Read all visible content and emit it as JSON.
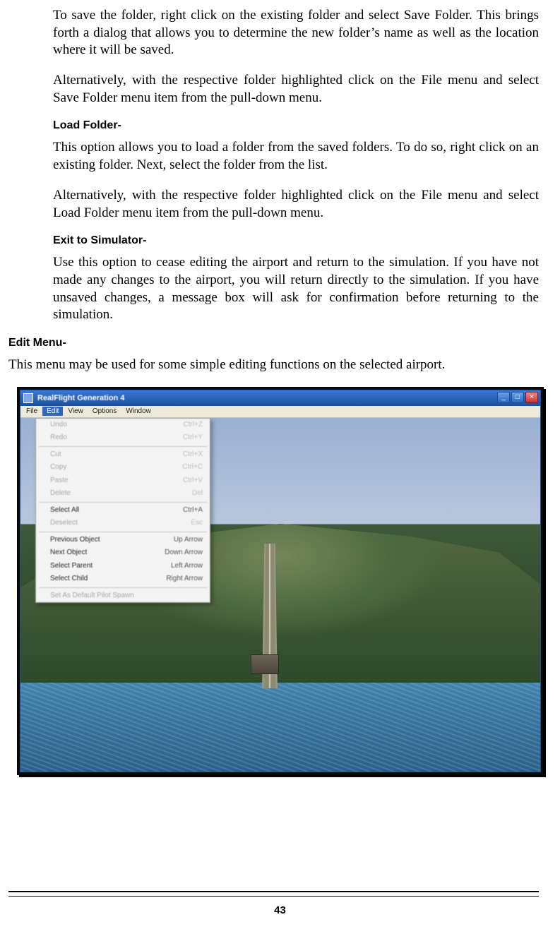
{
  "saveFolder": {
    "p1": "To save the folder, right click on the existing folder and select Save Folder. This brings forth a dialog that allows you to determine the new folder’s name as well as the location where it will be saved.",
    "p2": "Alternatively, with the respective folder highlighted click on the File menu and select Save Folder menu item from the pull-down menu."
  },
  "loadFolder": {
    "heading": "Load Folder-",
    "p1": "This option allows you to load a folder from the saved folders.  To do so, right click on an existing folder.  Next, select the folder from the list.",
    "p2": "Alternatively, with the respective folder highlighted click on the File menu and select Load Folder menu item from the pull-down menu."
  },
  "exitSim": {
    "heading": "Exit to Simulator-",
    "p1": "Use this option to cease editing the airport and return to the simulation.  If you have not made any changes to the airport, you will return directly to the simulation.  If you have unsaved changes, a message box will ask for confirmation before returning to the simulation."
  },
  "editMenu": {
    "heading": "Edit Menu-",
    "p1": "This menu may be used for some simple editing functions on the selected airport."
  },
  "window": {
    "title": "RealFlight Generation 4",
    "menus": {
      "file": "File",
      "edit": "Edit",
      "view": "View",
      "options": "Options",
      "window": "Window"
    },
    "editMenu": {
      "undo": {
        "label": "Undo",
        "shortcut": "Ctrl+Z",
        "enabled": false
      },
      "redo": {
        "label": "Redo",
        "shortcut": "Ctrl+Y",
        "enabled": false
      },
      "cut": {
        "label": "Cut",
        "shortcut": "Ctrl+X",
        "enabled": false
      },
      "copy": {
        "label": "Copy",
        "shortcut": "Ctrl+C",
        "enabled": false
      },
      "paste": {
        "label": "Paste",
        "shortcut": "Ctrl+V",
        "enabled": false
      },
      "delete": {
        "label": "Delete",
        "shortcut": "Del",
        "enabled": false
      },
      "selectAll": {
        "label": "Select All",
        "shortcut": "Ctrl+A",
        "enabled": true
      },
      "deselect": {
        "label": "Deselect",
        "shortcut": "Esc",
        "enabled": false
      },
      "prevObj": {
        "label": "Previous Object",
        "shortcut": "Up Arrow",
        "enabled": true
      },
      "nextObj": {
        "label": "Next Object",
        "shortcut": "Down Arrow",
        "enabled": true
      },
      "selParent": {
        "label": "Select Parent",
        "shortcut": "Left Arrow",
        "enabled": true
      },
      "selChild": {
        "label": "Select Child",
        "shortcut": "Right Arrow",
        "enabled": true
      },
      "setSpawn": {
        "label": "Set As Default Pilot Spawn",
        "shortcut": "",
        "enabled": false
      }
    }
  },
  "pageNumber": "43"
}
